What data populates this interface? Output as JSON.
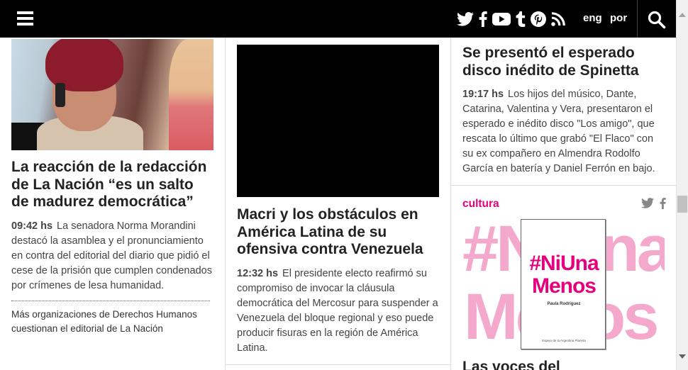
{
  "header": {
    "menu_icon": "hamburger-menu-icon",
    "social_icons": [
      "twitter-icon",
      "facebook-icon",
      "youtube-icon",
      "tumblr-icon",
      "pinterest-icon",
      "rss-icon"
    ],
    "lang_eng": "eng",
    "lang_por": "por",
    "search_icon": "search-icon"
  },
  "column1": {
    "headline": "La reacción de la redacción de La Nación “es un salto de madurez democrática”",
    "time": "09:42 hs",
    "summary": "La senadora Norma Morandini destacó la asamblea y el pronunciamiento en contra del editorial del diario que pidió el cese de la prisión que cumplen condenados por crímenes de lesa humanidad.",
    "related": "Más organizaciones de Derechos Humanos cuestionan el editorial de La Nación"
  },
  "column2": {
    "headline": "Macri y los obstáculos en América Latina de su ofensiva contra Venezuela",
    "time": "12:32 hs",
    "summary": "El presidente electo reafirmó su compromiso de invocar la cláusula democrática del Mercosur para suspender a Venezuela del bloque regional y eso puede producir fisuras en la región de América Latina."
  },
  "column3": {
    "headline": "Se presentó el esperado disco inédito de Spinetta",
    "time": "19:17 hs",
    "summary": "Los hijos del músico, Dante, Catarina, Valentina y Vera, presentaron el esperado e inédito disco \"Los amigo\", que rescata lo último que grabó \"El Flaco\" con su ex compañero en Almendra Rodolfo García en batería y Daniel Ferrón en bajo.",
    "section": "cultura",
    "promo_bg_line1": "#NiUna",
    "promo_bg_line2": "Menos",
    "book_title_line1": "#NiUna",
    "book_title_line2": "Menos",
    "book_author": "Paula Rodríguez",
    "book_publisher": "Espejo de la Argentina Planeta",
    "bottom_headline": "Las voces del"
  },
  "colors": {
    "topbar": "#000000",
    "accent": "#e6007e",
    "promo_pink": "#f4a8cc"
  }
}
